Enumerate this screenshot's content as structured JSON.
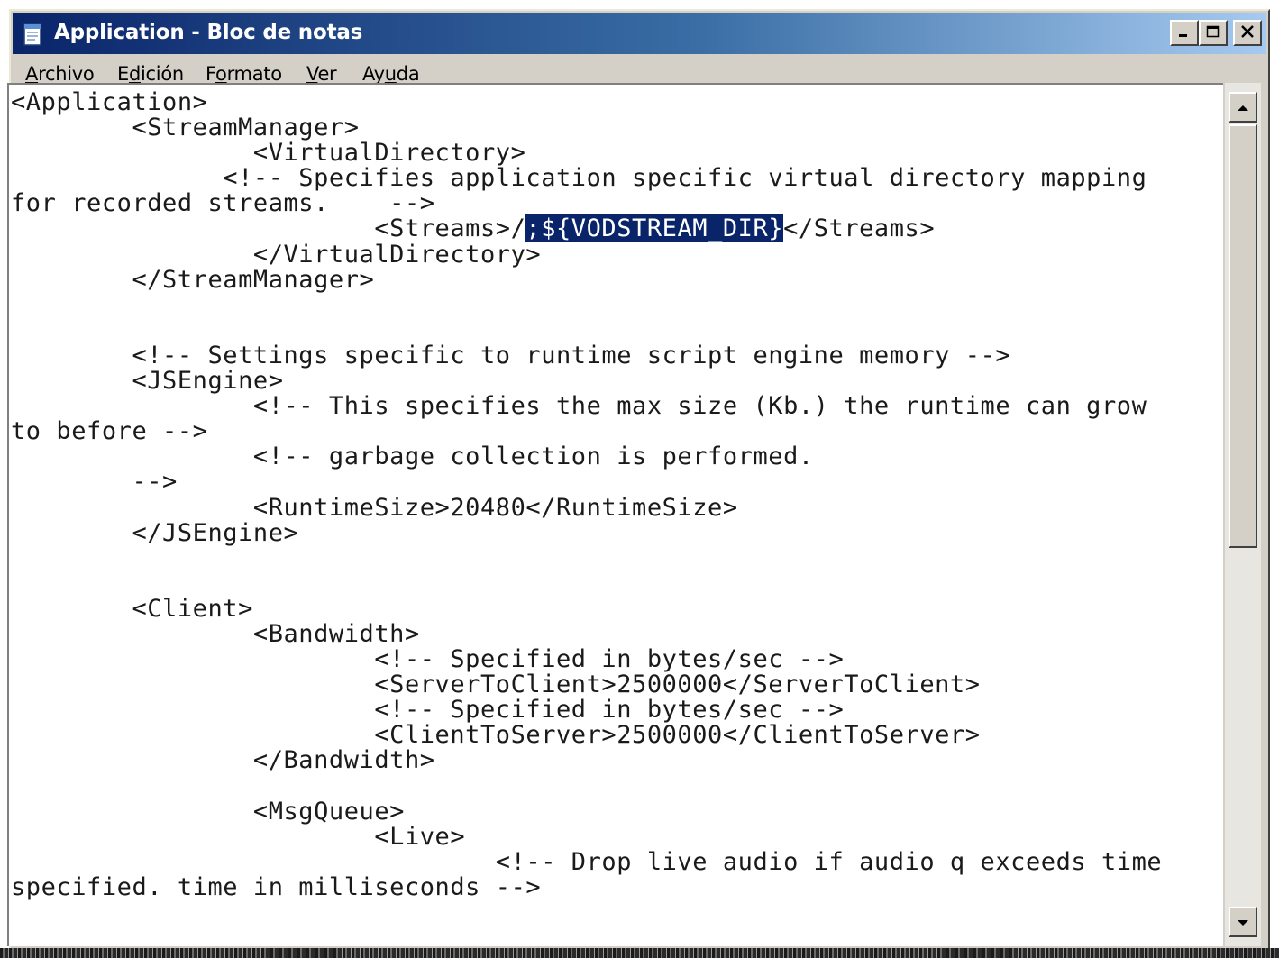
{
  "window": {
    "title": "Application - Bloc de notas",
    "icon": "notepad-icon"
  },
  "titlebar_buttons": {
    "minimize_icon": "minimize-icon",
    "maximize_icon": "maximize-icon",
    "close_icon": "close-icon"
  },
  "menu": {
    "items": [
      {
        "label_ul": "A",
        "label_rest": "rchivo"
      },
      {
        "label_pre": "E",
        "label_ul": "d",
        "label_rest": "ición"
      },
      {
        "label_pre": "F",
        "label_ul": "o",
        "label_rest": "rmato"
      },
      {
        "label_ul": "V",
        "label_rest": "er"
      },
      {
        "label_pre": "Ay",
        "label_ul": "u",
        "label_rest": "da"
      }
    ]
  },
  "editor": {
    "line_01": "<Application>",
    "line_02": "        <StreamManager>",
    "line_03": "                <VirtualDirectory>",
    "line_04": "              <!-- Specifies application specific virtual directory mapping",
    "line_05": "for recorded streams.    -->",
    "line_06_pre": "                        <Streams>/",
    "line_06_sel": ";${VODSTREAM_DIR}",
    "line_06_post": "</Streams>",
    "line_07": "                </VirtualDirectory>",
    "line_08": "        </StreamManager>",
    "line_09": "",
    "line_10": "",
    "line_11": "        <!-- Settings specific to runtime script engine memory -->",
    "line_12": "        <JSEngine>",
    "line_13": "                <!-- This specifies the max size (Kb.) the runtime can grow",
    "line_14": "to before -->",
    "line_15": "                <!-- garbage collection is performed.",
    "line_16": "        -->",
    "line_17": "                <RuntimeSize>20480</RuntimeSize>",
    "line_18": "        </JSEngine>",
    "line_19": "",
    "line_20": "",
    "line_21": "        <Client>",
    "line_22": "                <Bandwidth>",
    "line_23": "                        <!-- Specified in bytes/sec -->",
    "line_24": "                        <ServerToClient>2500000</ServerToClient>",
    "line_25": "                        <!-- Specified in bytes/sec -->",
    "line_26": "                        <ClientToServer>2500000</ClientToServer>",
    "line_27": "                </Bandwidth>",
    "line_28": "",
    "line_29": "                <MsgQueue>",
    "line_30": "                        <Live>",
    "line_31": "                                <!-- Drop live audio if audio q exceeds time",
    "line_32": "specified. time in milliseconds -->"
  },
  "scrollbar": {
    "up_icon": "scroll-up-arrow-icon",
    "down_icon": "scroll-down-arrow-icon",
    "position": 0.0
  },
  "colors": {
    "titlebar_start": "#0a246a",
    "titlebar_end": "#a6caf0",
    "selection": "#0a246a",
    "chrome": "#d4d0c8"
  }
}
